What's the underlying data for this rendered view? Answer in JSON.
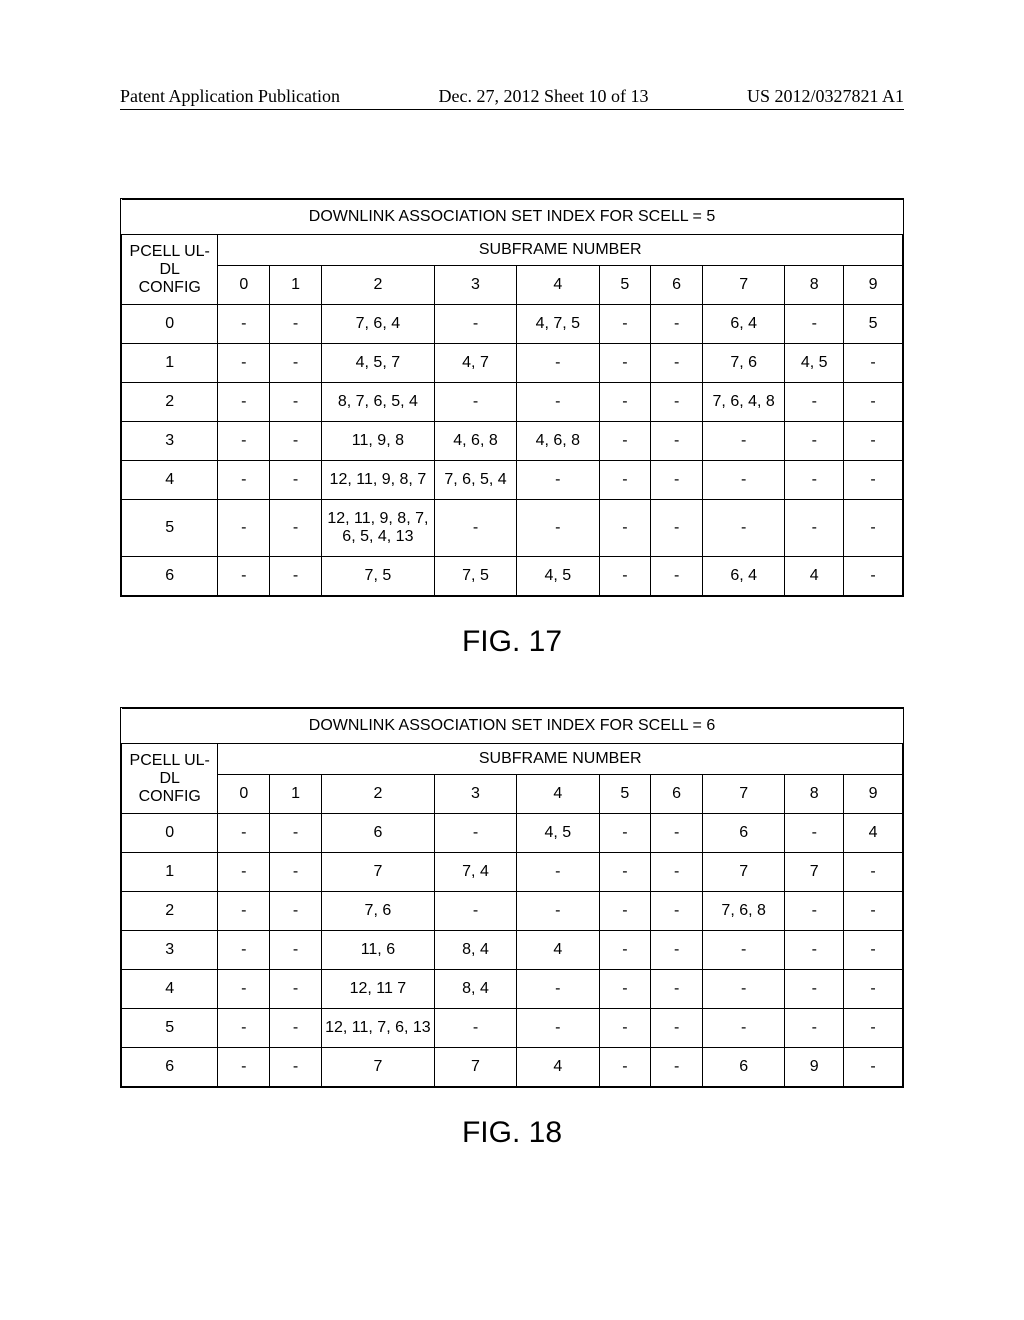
{
  "header": {
    "left": "Patent Application Publication",
    "center": "Dec. 27, 2012  Sheet 10 of 13",
    "right": "US 2012/0327821 A1"
  },
  "table17": {
    "title": "DOWNLINK ASSOCIATION SET INDEX FOR SCELL = 5",
    "row_header": "PCELL UL-DL CONFIG",
    "sub_header": "SUBFRAME NUMBER",
    "cols": [
      "0",
      "1",
      "2",
      "3",
      "4",
      "5",
      "6",
      "7",
      "8",
      "9"
    ],
    "rows": [
      {
        "cfg": "0",
        "c": [
          "-",
          "-",
          "7, 6, 4",
          "-",
          "4, 7, 5",
          "-",
          "-",
          "6, 4",
          "-",
          "5"
        ]
      },
      {
        "cfg": "1",
        "c": [
          "-",
          "-",
          "4, 5, 7",
          "4, 7",
          "-",
          "-",
          "-",
          "7, 6",
          "4, 5",
          "-"
        ]
      },
      {
        "cfg": "2",
        "c": [
          "-",
          "-",
          "8, 7, 6, 5, 4",
          "-",
          "-",
          "-",
          "-",
          "7, 6, 4, 8",
          "-",
          "-"
        ]
      },
      {
        "cfg": "3",
        "c": [
          "-",
          "-",
          "11, 9, 8",
          "4, 6, 8",
          "4, 6, 8",
          "-",
          "-",
          "-",
          "-",
          "-"
        ]
      },
      {
        "cfg": "4",
        "c": [
          "-",
          "-",
          "12, 11, 9, 8, 7",
          "7, 6, 5, 4",
          "-",
          "-",
          "-",
          "-",
          "-",
          "-"
        ]
      },
      {
        "cfg": "5",
        "c": [
          "-",
          "-",
          "12, 11, 9, 8, 7, 6, 5, 4, 13",
          "-",
          "-",
          "-",
          "-",
          "-",
          "-",
          "-"
        ]
      },
      {
        "cfg": "6",
        "c": [
          "-",
          "-",
          "7, 5",
          "7, 5",
          "4, 5",
          "-",
          "-",
          "6, 4",
          "4",
          "-"
        ]
      }
    ],
    "fig": "FIG. 17"
  },
  "table18": {
    "title": "DOWNLINK ASSOCIATION SET INDEX FOR SCELL = 6",
    "row_header": "PCELL UL-DL CONFIG",
    "sub_header": "SUBFRAME NUMBER",
    "cols": [
      "0",
      "1",
      "2",
      "3",
      "4",
      "5",
      "6",
      "7",
      "8",
      "9"
    ],
    "rows": [
      {
        "cfg": "0",
        "c": [
          "-",
          "-",
          "6",
          "-",
          "4, 5",
          "-",
          "-",
          "6",
          "-",
          "4"
        ]
      },
      {
        "cfg": "1",
        "c": [
          "-",
          "-",
          "7",
          "7, 4",
          "-",
          "-",
          "-",
          "7",
          "7",
          "-"
        ]
      },
      {
        "cfg": "2",
        "c": [
          "-",
          "-",
          "7, 6",
          "-",
          "-",
          "-",
          "-",
          "7, 6, 8",
          "-",
          "-"
        ]
      },
      {
        "cfg": "3",
        "c": [
          "-",
          "-",
          "11, 6",
          "8, 4",
          "4",
          "-",
          "-",
          "-",
          "-",
          "-"
        ]
      },
      {
        "cfg": "4",
        "c": [
          "-",
          "-",
          "12, 11 7",
          "8, 4",
          "-",
          "-",
          "-",
          "-",
          "-",
          "-"
        ]
      },
      {
        "cfg": "5",
        "c": [
          "-",
          "-",
          "12, 11, 7, 6, 13",
          "-",
          "-",
          "-",
          "-",
          "-",
          "-",
          "-"
        ]
      },
      {
        "cfg": "6",
        "c": [
          "-",
          "-",
          "7",
          "7",
          "4",
          "-",
          "-",
          "6",
          "9",
          "-"
        ]
      }
    ],
    "fig": "FIG. 18"
  }
}
